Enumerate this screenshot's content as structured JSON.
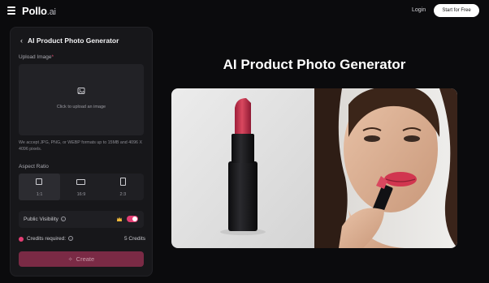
{
  "header": {
    "brand_name": "Pollo",
    "brand_suffix": ".ai",
    "login_label": "Login",
    "start_label": "Start for Free"
  },
  "panel": {
    "title": "AI Product Photo Generator",
    "upload_label": "Upload Image",
    "upload_required_mark": "*",
    "upload_prompt": "Click to upload an image",
    "upload_note": "We accept JPG, PNG, or WEBP formats up to 15MB and 4096 X 4096 pixels.",
    "aspect_label": "Aspect Ratio",
    "ratios": [
      {
        "label": "1:1",
        "active": true
      },
      {
        "label": "16:9",
        "active": false
      },
      {
        "label": "2:3",
        "active": false
      }
    ],
    "visibility_label": "Public Visibility",
    "visibility_on": true,
    "credits_label": "Credits required:",
    "credits_value": "5 Credits",
    "create_label": "Create"
  },
  "main": {
    "title": "AI Product Photo Generator"
  },
  "colors": {
    "accent": "#e33d73",
    "create_button": "#7a2a45",
    "background": "#0b0b0d",
    "panel": "#17171a"
  }
}
